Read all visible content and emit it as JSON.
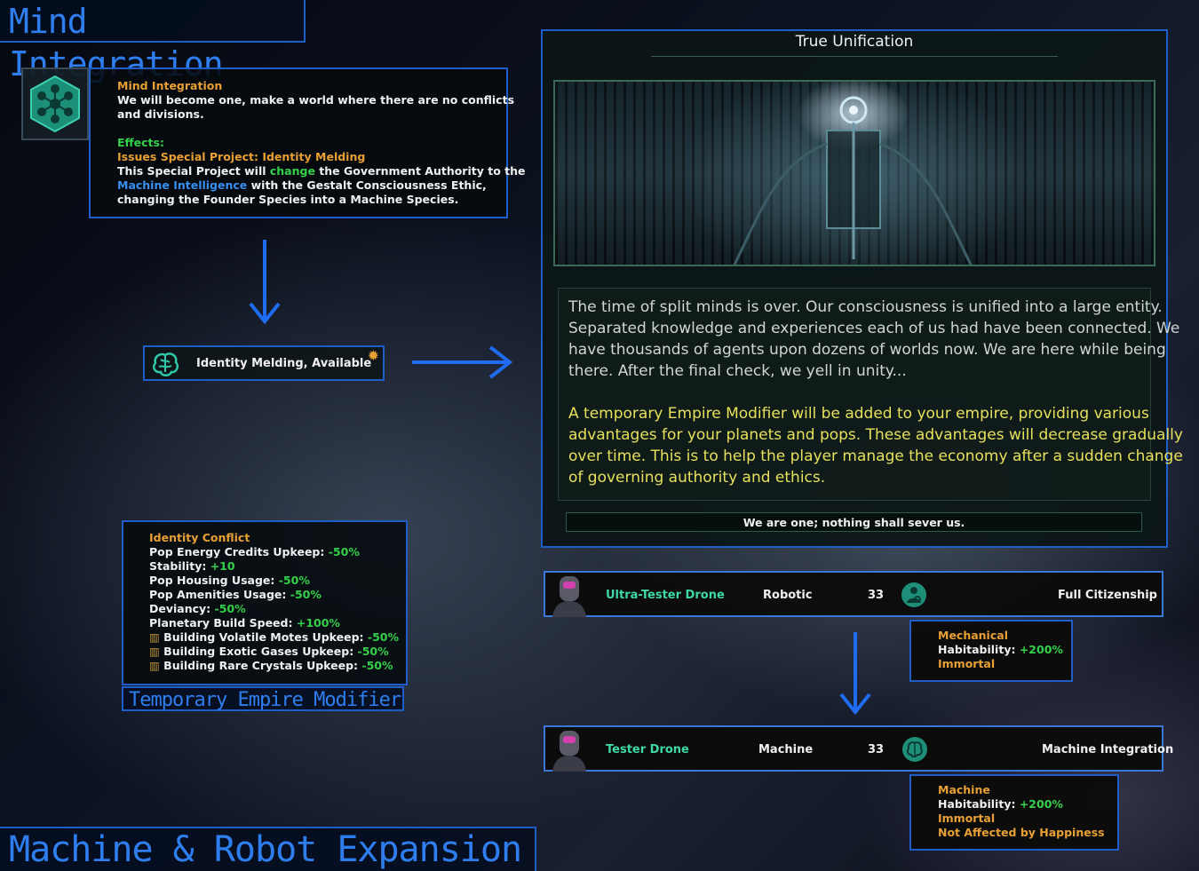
{
  "banners": {
    "top_title": "Mind Integration",
    "bottom_title": "Machine & Robot Expansion",
    "modifier_caption": "Temporary Empire Modifier"
  },
  "tradition": {
    "icon": "hex-node-network-icon",
    "name": "Mind Integration",
    "description_1": "We will become one, make a world where there are no conflicts",
    "description_2": "and divisions.",
    "effects_label": "Effects:",
    "issues_prefix": "Issues Special Project: ",
    "issues_project": "Identity Melding",
    "line_a1": "This Special Project will ",
    "line_a2": "change",
    "line_a3": " the Government Authority to the",
    "line_b1": "Machine Intelligence",
    "line_b2": " with the Gestalt Consciousness Ethic,",
    "line_c": "changing the Founder Species into a Machine Species."
  },
  "project": {
    "icon": "brain-icon",
    "label": "Identity Melding, Available",
    "gear_icon": "gear-icon"
  },
  "event": {
    "title": "True Unification",
    "body_1": "The time of split minds is over. Our consciousness is unified into a large entity.",
    "body_2": "Separated knowledge and experiences each of us had have been connected. We",
    "body_3": "have thousands of agents upon dozens of worlds now. We are here while being",
    "body_4": "there. After the final check, we yell in unity...",
    "note_1": "A temporary Empire Modifier will be added to your empire, providing various",
    "note_2": "advantages for your planets and pops. These advantages will decrease gradually",
    "note_3": "over time. This is to help the player manage the economy after a sudden change",
    "note_4": "of governing authority and ethics.",
    "response_button": "We are one; nothing shall sever us."
  },
  "modifier": {
    "name": "Identity Conflict",
    "lines": [
      {
        "label": "Pop Energy Credits Upkeep: ",
        "value": "-50%"
      },
      {
        "label": "Stability: ",
        "value": "+10"
      },
      {
        "label": "Pop Housing Usage: ",
        "value": "-50%"
      },
      {
        "label": "Pop Amenities Usage: ",
        "value": "-50%"
      },
      {
        "label": "Deviancy: ",
        "value": "-50%"
      },
      {
        "label": "Planetary Build Speed: ",
        "value": "+100%"
      }
    ],
    "building_lines": [
      {
        "label": "Building Volatile Motes Upkeep: ",
        "value": "-50%"
      },
      {
        "label": "Building Exotic Gases Upkeep: ",
        "value": "-50%"
      },
      {
        "label": "Building Rare Crystals Upkeep: ",
        "value": "-50%"
      }
    ],
    "building_icon": "building-icon"
  },
  "species_before": {
    "name": "Ultra-Tester Drone",
    "class": "Robotic",
    "count": "33",
    "status_icon": "gear-person-icon",
    "rights": "Full Citizenship",
    "trait_type": "Mechanical",
    "habitability_label": "Habitability: ",
    "habitability_value": "+200%",
    "trait_2": "Immortal"
  },
  "species_after": {
    "name": "Tester Drone",
    "class": "Machine",
    "count": "33",
    "status_icon": "brain-icon",
    "rights": "Machine Integration",
    "trait_type": "Machine",
    "habitability_label": "Habitability: ",
    "habitability_value": "+200%",
    "trait_2": "Immortal",
    "trait_3": "Not Affected by Happiness"
  },
  "colors": {
    "accent_blue": "#1f5ec9",
    "orange": "#e8a035",
    "green": "#35d04a",
    "event_yellow": "#e6e05a"
  }
}
